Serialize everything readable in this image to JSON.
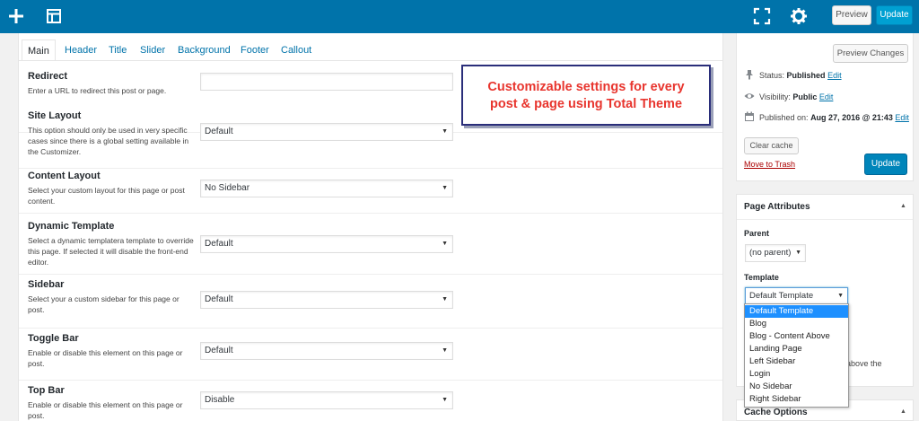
{
  "toolbar": {
    "add_icon": "plus-icon",
    "layout_icon": "layout-icon",
    "fullscreen_icon": "fullscreen-icon",
    "settings_icon": "gear-icon",
    "preview_label": "Preview",
    "update_label": "Update"
  },
  "tabs": [
    "Main",
    "Header",
    "Title",
    "Slider",
    "Background",
    "Footer",
    "Callout"
  ],
  "rows": [
    {
      "label": "Redirect",
      "desc": "Enter a URL to redirect this post or page.",
      "value": ""
    },
    {
      "label": "Site Layout",
      "desc": "This option should only be used in very specific cases since there is a global setting available in the Customizer.",
      "value": "Default"
    },
    {
      "label": "Content Layout",
      "desc": "Select your custom layout for this page or post content.",
      "value": "No Sidebar"
    },
    {
      "label": "Dynamic Template",
      "desc": "Select a dynamic templatera template to override this page. If selected it will disable the front-end editor.",
      "value": "Default"
    },
    {
      "label": "Sidebar",
      "desc": "Select your a custom sidebar for this page or post.",
      "value": "Default"
    },
    {
      "label": "Toggle Bar",
      "desc": "Enable or disable this element on this page or post.",
      "value": "Default"
    },
    {
      "label": "Top Bar",
      "desc": "Enable or disable this element on this page or post.",
      "value": "Disable"
    }
  ],
  "callout": {
    "line1": "Customizable settings for every",
    "line2": "post & page using Total Theme"
  },
  "publish": {
    "preview_changes_label": "Preview Changes",
    "status_label": "Status:",
    "status_value": "Published",
    "visibility_label": "Visibility:",
    "visibility_value": "Public",
    "published_label": "Published on:",
    "published_value": "Aug 27, 2016 @ 21:43",
    "edit_label": "Edit",
    "clear_cache_label": "Clear cache",
    "trash_label": "Move to Trash",
    "update_label": "Update"
  },
  "page_attributes": {
    "title": "Page Attributes",
    "parent_label": "Parent",
    "parent_value": "(no parent)",
    "template_label": "Template",
    "template_value": "Default Template",
    "template_options": [
      "Default Template",
      "Blog",
      "Blog - Content Above",
      "Landing Page",
      "Left Sidebar",
      "Login",
      "No Sidebar",
      "Right Sidebar"
    ],
    "tail_text": "above the"
  },
  "cache_options": {
    "title": "Cache Options"
  },
  "colors": {
    "toolbar_bg": "#0073aa",
    "link": "#0073aa",
    "callout_text": "#e8352e",
    "callout_border": "#2a2e7a",
    "trash": "#a00"
  }
}
